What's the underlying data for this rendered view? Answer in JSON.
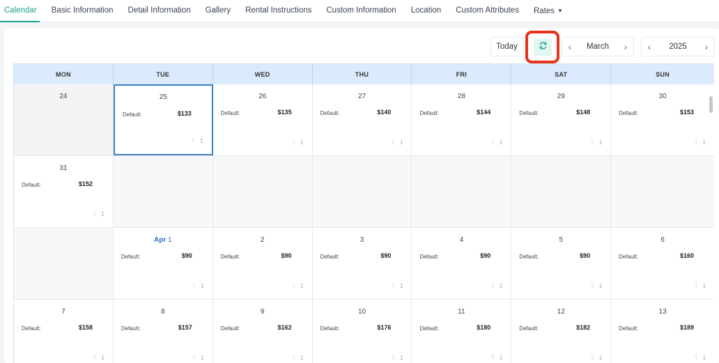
{
  "tabs": [
    {
      "label": "Calendar",
      "active": true
    },
    {
      "label": "Basic Information"
    },
    {
      "label": "Detail Information"
    },
    {
      "label": "Gallery"
    },
    {
      "label": "Rental Instructions"
    },
    {
      "label": "Custom Information"
    },
    {
      "label": "Location"
    },
    {
      "label": "Custom Attributes"
    },
    {
      "label": "Rates"
    }
  ],
  "toolbar": {
    "today_label": "Today",
    "refresh_icon": "refresh-icon",
    "month": "March",
    "year": "2025"
  },
  "weekdays": [
    "MON",
    "TUE",
    "WED",
    "THU",
    "FRI",
    "SAT",
    "SUN"
  ],
  "weeks": [
    [
      {
        "day": "24",
        "past": true
      },
      {
        "day": "25",
        "rate_label": "Default:",
        "rate": "$133",
        "nights": "1",
        "selected": true
      },
      {
        "day": "26",
        "rate_label": "Default:",
        "rate": "$135",
        "nights": "1"
      },
      {
        "day": "27",
        "rate_label": "Default:",
        "rate": "$140",
        "nights": "1"
      },
      {
        "day": "28",
        "rate_label": "Default:",
        "rate": "$144",
        "nights": "1"
      },
      {
        "day": "29",
        "rate_label": "Default:",
        "rate": "$148",
        "nights": "1"
      },
      {
        "day": "30",
        "rate_label": "Default:",
        "rate": "$153",
        "nights": "1"
      }
    ],
    [
      {
        "day": "31",
        "rate_label": "Default:",
        "rate": "$152",
        "nights": "1"
      },
      {
        "empty": true
      },
      {
        "empty": true
      },
      {
        "empty": true
      },
      {
        "empty": true
      },
      {
        "empty": true
      },
      {
        "empty": true
      }
    ],
    [
      {
        "empty": true
      },
      {
        "day": "1",
        "month_prefix": "Apr",
        "rate_label": "Default:",
        "rate": "$90",
        "nights": "1"
      },
      {
        "day": "2",
        "rate_label": "Default:",
        "rate": "$90",
        "nights": "1"
      },
      {
        "day": "3",
        "rate_label": "Default:",
        "rate": "$90",
        "nights": "1"
      },
      {
        "day": "4",
        "rate_label": "Default:",
        "rate": "$90",
        "nights": "1"
      },
      {
        "day": "5",
        "rate_label": "Default:",
        "rate": "$90",
        "nights": "1"
      },
      {
        "day": "6",
        "rate_label": "Default:",
        "rate": "$160",
        "nights": "1"
      }
    ],
    [
      {
        "day": "7",
        "rate_label": "Default:",
        "rate": "$158",
        "nights": "1"
      },
      {
        "day": "8",
        "rate_label": "Default:",
        "rate": "$157",
        "nights": "1"
      },
      {
        "day": "9",
        "rate_label": "Default:",
        "rate": "$162",
        "nights": "1"
      },
      {
        "day": "10",
        "rate_label": "Default:",
        "rate": "$176",
        "nights": "1"
      },
      {
        "day": "11",
        "rate_label": "Default:",
        "rate": "$180",
        "nights": "1"
      },
      {
        "day": "12",
        "rate_label": "Default:",
        "rate": "$182",
        "nights": "1"
      },
      {
        "day": "13",
        "rate_label": "Default:",
        "rate": "$189",
        "nights": "1"
      }
    ]
  ],
  "colors": {
    "accent": "#14a38b",
    "highlight": "#e8321b",
    "header_bg": "#dbeafc"
  }
}
